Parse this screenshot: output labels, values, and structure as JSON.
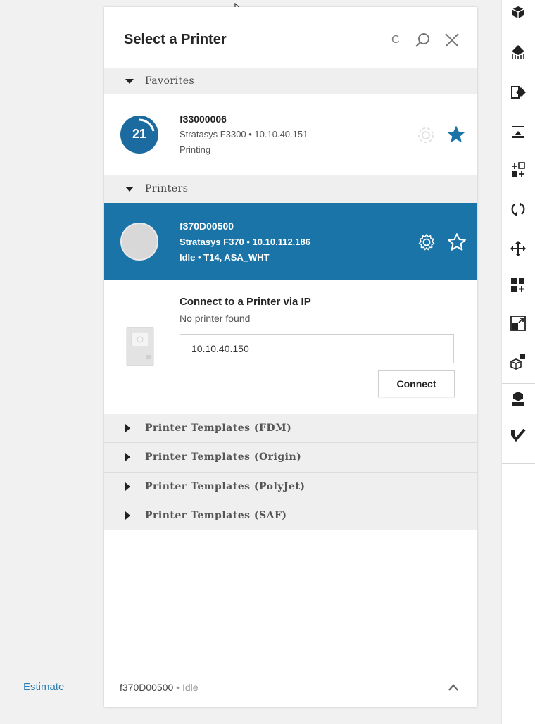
{
  "panel": {
    "title": "Select a Printer",
    "refresh_glyph": "C"
  },
  "sections": {
    "favorites": "Favorites",
    "printers": "Printers",
    "templates": [
      "Printer Templates (FDM)",
      "Printer Templates (Origin)",
      "Printer Templates (PolyJet)",
      "Printer Templates (SAF)"
    ]
  },
  "favorite_printer": {
    "badge": "21",
    "name": "f33000006",
    "detail": "Stratasys F3300 • 10.10.40.151",
    "status": "Printing",
    "favorited": true
  },
  "selected_printer": {
    "name": "f370D00500",
    "detail": "Stratasys F370 • 10.10.112.186",
    "status": "Idle • T14, ASA_WHT",
    "favorited": false
  },
  "connect_ip": {
    "title": "Connect to a Printer via IP",
    "subtitle": "No printer found",
    "ip_value": "10.10.40.150",
    "button": "Connect"
  },
  "footer": {
    "printer_name": "f370D00500",
    "status": " • Idle"
  },
  "side": {
    "estimate_label": "Estimate"
  },
  "colors": {
    "accent": "#1a74a8",
    "badge": "#1b6aa0",
    "link": "#2a7db3",
    "section_bg": "#efefef"
  },
  "toolbar_icons": [
    "packing-icon",
    "orient-icon",
    "place-face-icon",
    "drop-to-tray-icon",
    "arrange-icon",
    "rotate-icon",
    "move-icon",
    "add-copies-icon",
    "scale-icon",
    "cubes-icon",
    "part-settings-icon",
    "check-icon"
  ]
}
